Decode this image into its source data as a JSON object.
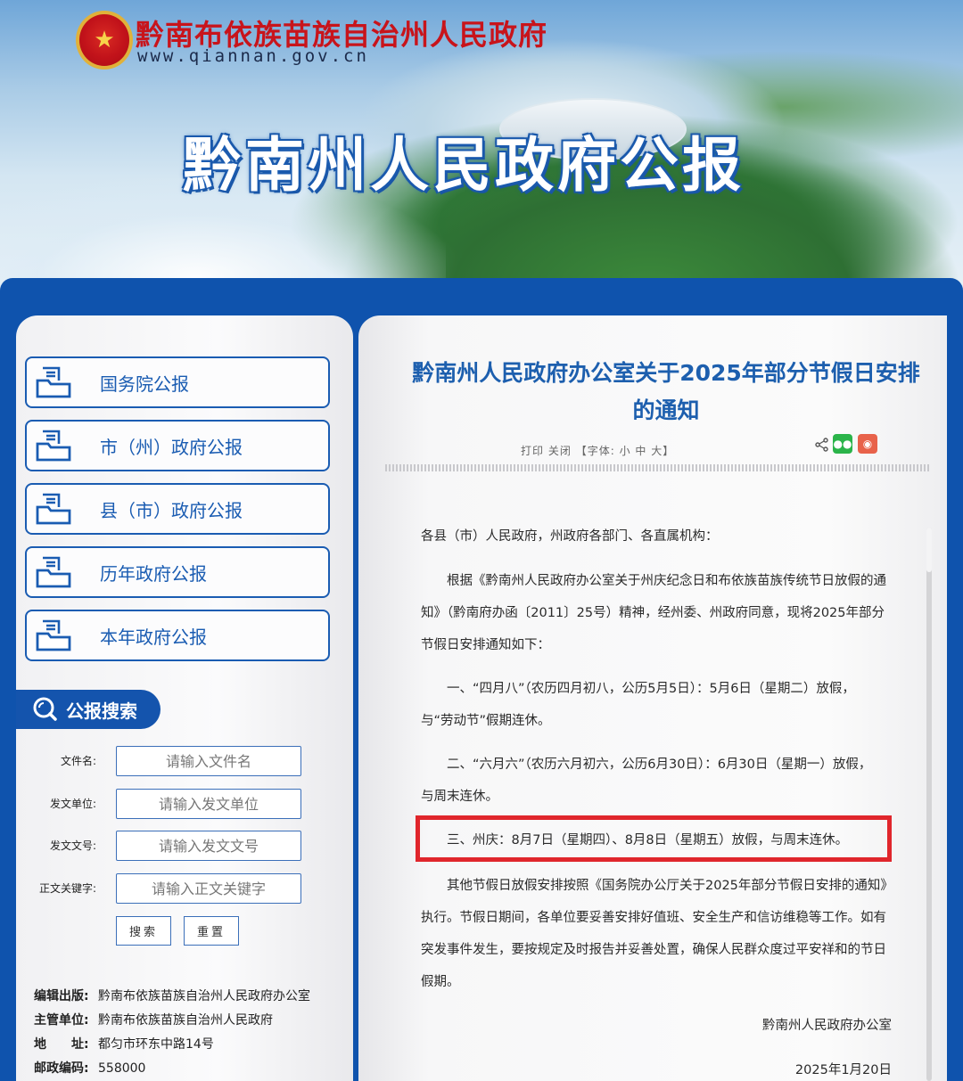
{
  "header": {
    "site_name": "黔南布依族苗族自治州人民政府",
    "site_url": "www.qiannan.gov.cn",
    "banner_title": "黔南州人民政府公报",
    "emblem_icon": "national-emblem-icon"
  },
  "sidebar": {
    "nav_items": [
      {
        "label": "国务院公报",
        "icon": "document-icon"
      },
      {
        "label": "市（州）政府公报",
        "icon": "document-icon"
      },
      {
        "label": "县（市）政府公报",
        "icon": "document-icon"
      },
      {
        "label": "历年政府公报",
        "icon": "document-icon"
      },
      {
        "label": "本年政府公报",
        "icon": "document-icon"
      }
    ],
    "search": {
      "title": "公报搜索",
      "fields": [
        {
          "label": "文件名:",
          "placeholder": "请输入文件名"
        },
        {
          "label": "发文单位:",
          "placeholder": "请输入发文单位"
        },
        {
          "label": "发文文号:",
          "placeholder": "请输入发文文号"
        },
        {
          "label": "正文关键字:",
          "placeholder": "请输入正文关键字"
        }
      ],
      "search_label": "搜索",
      "reset_label": "重置"
    },
    "info": [
      {
        "key": "编辑出版:",
        "value": "黔南布依族苗族自治州人民政府办公室"
      },
      {
        "key": "主管单位:",
        "value": "黔南布依族苗族自治州人民政府"
      },
      {
        "key": "地　　址:",
        "value": "都匀市环东中路14号"
      },
      {
        "key": "邮政编码:",
        "value": "558000"
      }
    ]
  },
  "article": {
    "title_line1": "黔南州人民政府办公室关于2025年部分节假日安排",
    "title_line2": "的通知",
    "tools": {
      "print": "打印",
      "close": "关闭",
      "font_label": "【字体:",
      "small": "小",
      "medium": "中",
      "large": "大】"
    },
    "salutation": "各县（市）人民政府，州政府各部门、各直属机构：",
    "para1": [
      "　　根据《黔南州人民政府办公室关于州庆纪念日和布依族苗族传统节日放假的通",
      "知》（黔南府办函〔2011〕25号）精神，经州委、州政府同意，现将2025年部分",
      "节假日安排通知如下："
    ],
    "item1": [
      "　　一、“四月八”（农历四月初八，公历5月5日）：5月6日（星期二）放假，",
      "与“劳动节”假期连休。"
    ],
    "item2": [
      "　　二、“六月六”（农历六月初六，公历6月30日）：6月30日（星期一）放假，",
      "与周末连休。"
    ],
    "item3": "　　三、州庆：8月7日（星期四）、8月8日（星期五）放假，与周末连休。",
    "para2": [
      "　　其他节假日放假安排按照《国务院办公厅关于2025年部分节假日安排的通知》",
      "执行。节假日期间，各单位要妥善安排好值班、安全生产和信访维稳等工作。如有",
      "突发事件发生，要按规定及时报告并妥善处置，确保人民群众度过平安祥和的节日",
      "假期。"
    ],
    "signature": "黔南州人民政府办公室",
    "date": "2025年1月20日"
  },
  "colors": {
    "frame_blue": "#0f53ad",
    "title_blue": "#1d5fae",
    "site_red": "#c8141b",
    "highlight_red": "#e0262c",
    "wechat_green": "#2bb44a",
    "weibo_orange": "#e8624a"
  }
}
